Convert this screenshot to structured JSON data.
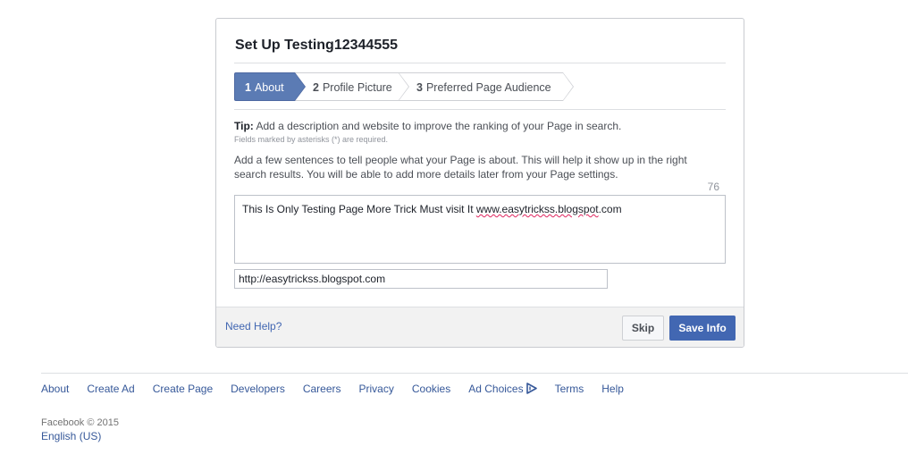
{
  "dialog": {
    "title": "Set Up Testing12344555",
    "steps": [
      {
        "number": "1",
        "label": "About",
        "active": true
      },
      {
        "number": "2",
        "label": "Profile Picture",
        "active": false
      },
      {
        "number": "3",
        "label": "Preferred Page Audience",
        "active": false
      }
    ],
    "tip_label": "Tip:",
    "tip_text": "Add a description and website to improve the ranking of your Page in search.",
    "required_note": "Fields marked by asterisks (*) are required.",
    "description_prompt": "Add a few sentences to tell people what your Page is about. This will help it show up in the right search results. You will be able to add more details later from your Page settings.",
    "char_counter": "76",
    "about_text_prefix": "This Is Only Testing Page More Trick Must visit It ",
    "about_text_url": "www.easytrickss.blogspot",
    "about_text_suffix": ".com",
    "website_value": "http://easytrickss.blogspot.com",
    "need_help": "Need Help?",
    "skip_label": "Skip",
    "save_label": "Save Info"
  },
  "footer": {
    "links": [
      "About",
      "Create Ad",
      "Create Page",
      "Developers",
      "Careers",
      "Privacy",
      "Cookies",
      "Ad Choices",
      "Terms",
      "Help"
    ],
    "copyright": "Facebook © 2015",
    "language": "English (US)"
  },
  "colors": {
    "active_step": "#5b7bb4",
    "primary_button": "#4267b2",
    "link": "#365899"
  }
}
